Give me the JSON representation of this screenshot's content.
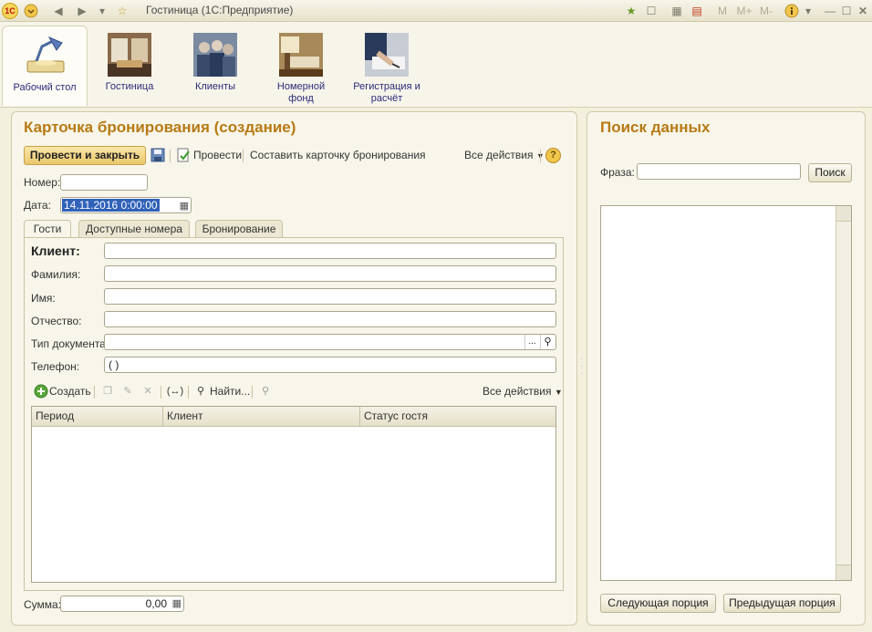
{
  "window": {
    "title": "Гостиница  (1С:Предприятие)",
    "logo": "1C",
    "toolbar_icons": [
      "menu-dropdown-icon",
      "back-arrow-icon",
      "forward-arrow-icon",
      "history-dropdown-icon",
      "favorite-star-icon"
    ],
    "right_icons": {
      "m": "M",
      "m_plus": "M+",
      "m_minus": "M-"
    }
  },
  "sections": [
    {
      "label": "Рабочий стол",
      "icon": "desktop-lamp-icon",
      "active": true
    },
    {
      "label": "Гостиница",
      "icon": "hotel-lobby-icon",
      "active": false
    },
    {
      "label": "Клиенты",
      "icon": "clients-crowd-icon",
      "active": false
    },
    {
      "label": "Номерной фонд",
      "icon": "hotel-room-icon",
      "active": false
    },
    {
      "label": "Регистрация и расчёт",
      "icon": "registration-handshake-icon",
      "active": false
    }
  ],
  "form": {
    "title": "Карточка бронирования (создание)",
    "toolbar": {
      "post_close": "Провести и закрыть",
      "post": "Провести",
      "make_card": "Составить карточку бронирования",
      "all_actions": "Все действия",
      "help": "?"
    },
    "number_label": "Номер:",
    "number_value": "",
    "date_label": "Дата:",
    "date_value": "14.11.2016  0:00:00",
    "tabs": [
      "Гости",
      "Доступные номера",
      "Бронирование"
    ],
    "client_label": "Клиент:",
    "client_value": "",
    "lastname_label": "Фамилия:",
    "firstname_label": "Имя:",
    "patronymic_label": "Отчество:",
    "doctype_label": "Тип документа:",
    "phone_label": "Телефон:",
    "phone_value": "(  )",
    "table_toolbar": {
      "create": "Создать",
      "find": "Найти...",
      "all_actions": "Все действия",
      "ellipsis": "..."
    },
    "table_columns": [
      "Период",
      "Клиент",
      "Статус гостя"
    ],
    "sum_label": "Сумма:",
    "sum_value": "0,00"
  },
  "search": {
    "title": "Поиск данных",
    "phrase_label": "Фраза:",
    "phrase_value": "",
    "search_button": "Поиск",
    "next_button": "Следующая порция",
    "prev_button": "Предыдущая порция"
  },
  "colors": {
    "accent_title": "#b77a14",
    "background": "#f3f0de"
  }
}
